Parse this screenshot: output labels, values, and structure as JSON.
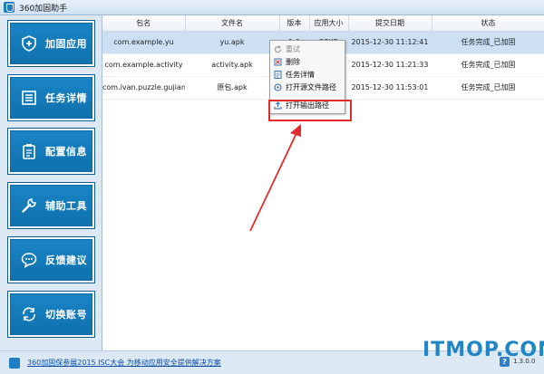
{
  "app": {
    "title": "360加固助手"
  },
  "sidebar": {
    "items": [
      {
        "label": "加固应用",
        "icon": "shield-plus-icon"
      },
      {
        "label": "任务详情",
        "icon": "task-list-icon"
      },
      {
        "label": "配置信息",
        "icon": "clipboard-icon"
      },
      {
        "label": "辅助工具",
        "icon": "wrench-icon"
      },
      {
        "label": "反馈建议",
        "icon": "chat-bubble-icon"
      },
      {
        "label": "切换账号",
        "icon": "switch-account-icon"
      }
    ]
  },
  "table": {
    "columns": [
      "包名",
      "文件名",
      "版本",
      "应用大小",
      "提交日期",
      "状态"
    ],
    "rows": [
      {
        "package": "com.example.yu",
        "file": "yu.apk",
        "version": "1.0",
        "size": "27KB",
        "date": "2015-12-30 11:12:41",
        "status": "任务完成_已加固",
        "selected": true
      },
      {
        "package": "com.example.activity",
        "file": "activity.apk",
        "version": "",
        "size": "",
        "date": "2015-12-30 11:21:33",
        "status": "任务完成_已加固",
        "selected": false
      },
      {
        "package": "com.ivan.puzzle.gujianq...",
        "file": "原包.apk",
        "version": "",
        "size": "",
        "date": "2015-12-30 11:53:01",
        "status": "任务完成_已加固",
        "selected": false
      }
    ]
  },
  "context_menu": {
    "items": [
      {
        "label": "重试",
        "icon": "retry-icon",
        "disabled": true
      },
      {
        "label": "删除",
        "icon": "delete-icon",
        "disabled": false
      },
      {
        "label": "任务详情",
        "icon": "detail-icon",
        "disabled": false
      },
      {
        "label": "打开源文件路径",
        "icon": "open-source-icon",
        "disabled": false
      },
      {
        "label": "打开输出路径",
        "icon": "open-output-icon",
        "disabled": false
      }
    ]
  },
  "statusbar": {
    "link": "360加固保参展2015 ISC大会 为移动应用安全提供解决方案",
    "version": "1.3.0.0"
  },
  "watermark": "ITMOP.COM",
  "colors": {
    "accent": "#1a86c7",
    "highlight": "#e22b2b",
    "link": "#0b4ea8"
  }
}
